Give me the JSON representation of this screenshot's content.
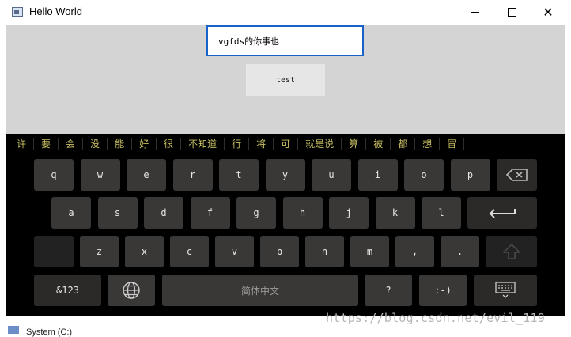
{
  "window": {
    "title": "Hello World"
  },
  "main": {
    "input_value": "vgfds的你事也",
    "test_button_label": "test"
  },
  "keyboard": {
    "candidates": [
      "许",
      "要",
      "会",
      "没",
      "能",
      "好",
      "很",
      "不知道",
      "行",
      "将",
      "可",
      "就是说",
      "算",
      "被",
      "都",
      "想",
      "冒"
    ],
    "row1": [
      "q",
      "w",
      "e",
      "r",
      "t",
      "y",
      "u",
      "i",
      "o",
      "p"
    ],
    "row2": [
      "a",
      "s",
      "d",
      "f",
      "g",
      "h",
      "j",
      "k",
      "l"
    ],
    "row3": [
      "z",
      "x",
      "c",
      "v",
      "b",
      "n",
      "m",
      ",",
      "."
    ],
    "symbols_label": "&123",
    "space_label": "简体中文",
    "question_label": "?",
    "smiley_label": ":-)",
    "icons": {
      "backspace": "backspace-icon",
      "enter": "enter-icon",
      "shift": "shift-icon",
      "globe": "globe-icon",
      "hide": "keyboard-hide-icon"
    }
  },
  "background": {
    "partial_label": "System (C:)"
  },
  "watermark": "https://blog.csdn.net/evil_119"
}
